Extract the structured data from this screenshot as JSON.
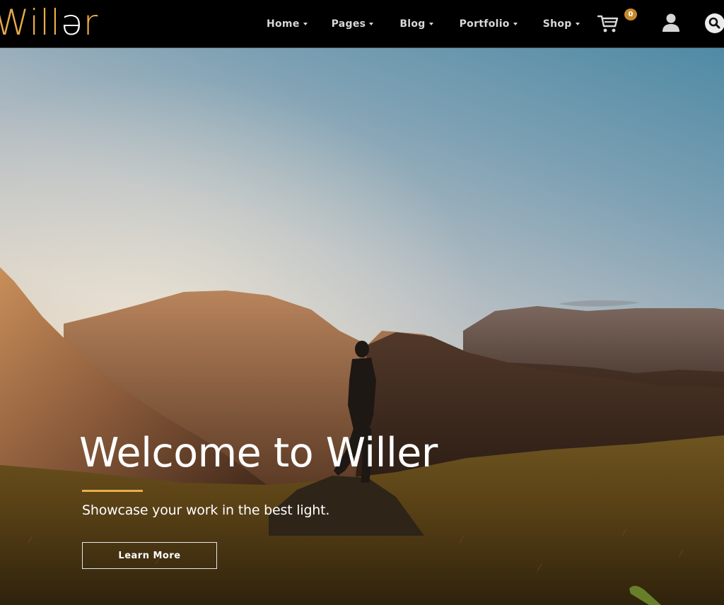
{
  "brand": {
    "logo_main": "Will",
    "logo_accent": "ə",
    "logo_end": "r",
    "accent_color": "#e9a94a"
  },
  "nav": {
    "items": [
      {
        "label": "Home",
        "has_dropdown": true
      },
      {
        "label": "Pages",
        "has_dropdown": true
      },
      {
        "label": "Blog",
        "has_dropdown": true
      },
      {
        "label": "Portfolio",
        "has_dropdown": true
      },
      {
        "label": "Shop",
        "has_dropdown": true
      }
    ],
    "cart_count": "0",
    "icons": [
      "cart-icon",
      "user-icon",
      "search-icon"
    ]
  },
  "hero": {
    "title": "Welcome to Willer",
    "subtitle": "Showcase your work in the best light.",
    "cta_label": "Learn More",
    "rule_color": "#e9ad4c"
  }
}
